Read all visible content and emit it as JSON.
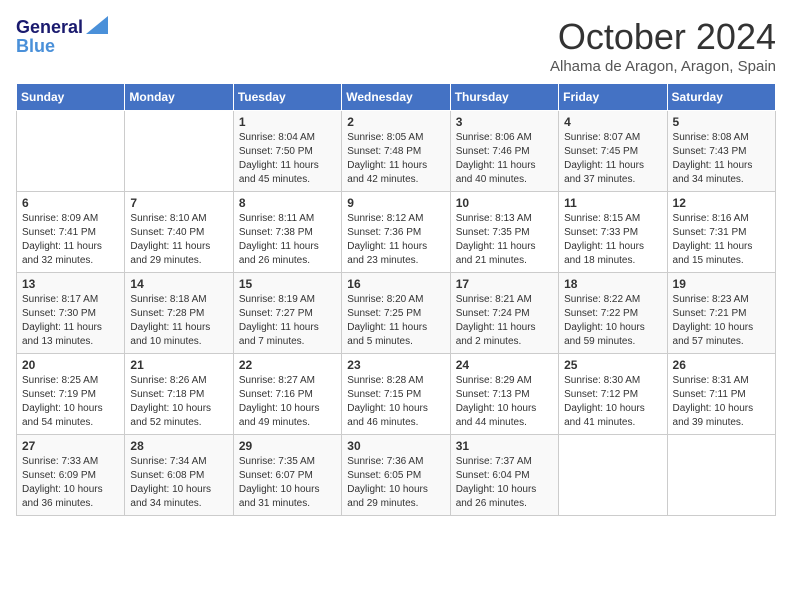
{
  "header": {
    "logo_line1": "General",
    "logo_line2": "Blue",
    "month": "October 2024",
    "location": "Alhama de Aragon, Aragon, Spain"
  },
  "days_of_week": [
    "Sunday",
    "Monday",
    "Tuesday",
    "Wednesday",
    "Thursday",
    "Friday",
    "Saturday"
  ],
  "weeks": [
    [
      {
        "day": "",
        "info": ""
      },
      {
        "day": "",
        "info": ""
      },
      {
        "day": "1",
        "info": "Sunrise: 8:04 AM\nSunset: 7:50 PM\nDaylight: 11 hours and 45 minutes."
      },
      {
        "day": "2",
        "info": "Sunrise: 8:05 AM\nSunset: 7:48 PM\nDaylight: 11 hours and 42 minutes."
      },
      {
        "day": "3",
        "info": "Sunrise: 8:06 AM\nSunset: 7:46 PM\nDaylight: 11 hours and 40 minutes."
      },
      {
        "day": "4",
        "info": "Sunrise: 8:07 AM\nSunset: 7:45 PM\nDaylight: 11 hours and 37 minutes."
      },
      {
        "day": "5",
        "info": "Sunrise: 8:08 AM\nSunset: 7:43 PM\nDaylight: 11 hours and 34 minutes."
      }
    ],
    [
      {
        "day": "6",
        "info": "Sunrise: 8:09 AM\nSunset: 7:41 PM\nDaylight: 11 hours and 32 minutes."
      },
      {
        "day": "7",
        "info": "Sunrise: 8:10 AM\nSunset: 7:40 PM\nDaylight: 11 hours and 29 minutes."
      },
      {
        "day": "8",
        "info": "Sunrise: 8:11 AM\nSunset: 7:38 PM\nDaylight: 11 hours and 26 minutes."
      },
      {
        "day": "9",
        "info": "Sunrise: 8:12 AM\nSunset: 7:36 PM\nDaylight: 11 hours and 23 minutes."
      },
      {
        "day": "10",
        "info": "Sunrise: 8:13 AM\nSunset: 7:35 PM\nDaylight: 11 hours and 21 minutes."
      },
      {
        "day": "11",
        "info": "Sunrise: 8:15 AM\nSunset: 7:33 PM\nDaylight: 11 hours and 18 minutes."
      },
      {
        "day": "12",
        "info": "Sunrise: 8:16 AM\nSunset: 7:31 PM\nDaylight: 11 hours and 15 minutes."
      }
    ],
    [
      {
        "day": "13",
        "info": "Sunrise: 8:17 AM\nSunset: 7:30 PM\nDaylight: 11 hours and 13 minutes."
      },
      {
        "day": "14",
        "info": "Sunrise: 8:18 AM\nSunset: 7:28 PM\nDaylight: 11 hours and 10 minutes."
      },
      {
        "day": "15",
        "info": "Sunrise: 8:19 AM\nSunset: 7:27 PM\nDaylight: 11 hours and 7 minutes."
      },
      {
        "day": "16",
        "info": "Sunrise: 8:20 AM\nSunset: 7:25 PM\nDaylight: 11 hours and 5 minutes."
      },
      {
        "day": "17",
        "info": "Sunrise: 8:21 AM\nSunset: 7:24 PM\nDaylight: 11 hours and 2 minutes."
      },
      {
        "day": "18",
        "info": "Sunrise: 8:22 AM\nSunset: 7:22 PM\nDaylight: 10 hours and 59 minutes."
      },
      {
        "day": "19",
        "info": "Sunrise: 8:23 AM\nSunset: 7:21 PM\nDaylight: 10 hours and 57 minutes."
      }
    ],
    [
      {
        "day": "20",
        "info": "Sunrise: 8:25 AM\nSunset: 7:19 PM\nDaylight: 10 hours and 54 minutes."
      },
      {
        "day": "21",
        "info": "Sunrise: 8:26 AM\nSunset: 7:18 PM\nDaylight: 10 hours and 52 minutes."
      },
      {
        "day": "22",
        "info": "Sunrise: 8:27 AM\nSunset: 7:16 PM\nDaylight: 10 hours and 49 minutes."
      },
      {
        "day": "23",
        "info": "Sunrise: 8:28 AM\nSunset: 7:15 PM\nDaylight: 10 hours and 46 minutes."
      },
      {
        "day": "24",
        "info": "Sunrise: 8:29 AM\nSunset: 7:13 PM\nDaylight: 10 hours and 44 minutes."
      },
      {
        "day": "25",
        "info": "Sunrise: 8:30 AM\nSunset: 7:12 PM\nDaylight: 10 hours and 41 minutes."
      },
      {
        "day": "26",
        "info": "Sunrise: 8:31 AM\nSunset: 7:11 PM\nDaylight: 10 hours and 39 minutes."
      }
    ],
    [
      {
        "day": "27",
        "info": "Sunrise: 7:33 AM\nSunset: 6:09 PM\nDaylight: 10 hours and 36 minutes."
      },
      {
        "day": "28",
        "info": "Sunrise: 7:34 AM\nSunset: 6:08 PM\nDaylight: 10 hours and 34 minutes."
      },
      {
        "day": "29",
        "info": "Sunrise: 7:35 AM\nSunset: 6:07 PM\nDaylight: 10 hours and 31 minutes."
      },
      {
        "day": "30",
        "info": "Sunrise: 7:36 AM\nSunset: 6:05 PM\nDaylight: 10 hours and 29 minutes."
      },
      {
        "day": "31",
        "info": "Sunrise: 7:37 AM\nSunset: 6:04 PM\nDaylight: 10 hours and 26 minutes."
      },
      {
        "day": "",
        "info": ""
      },
      {
        "day": "",
        "info": ""
      }
    ]
  ]
}
